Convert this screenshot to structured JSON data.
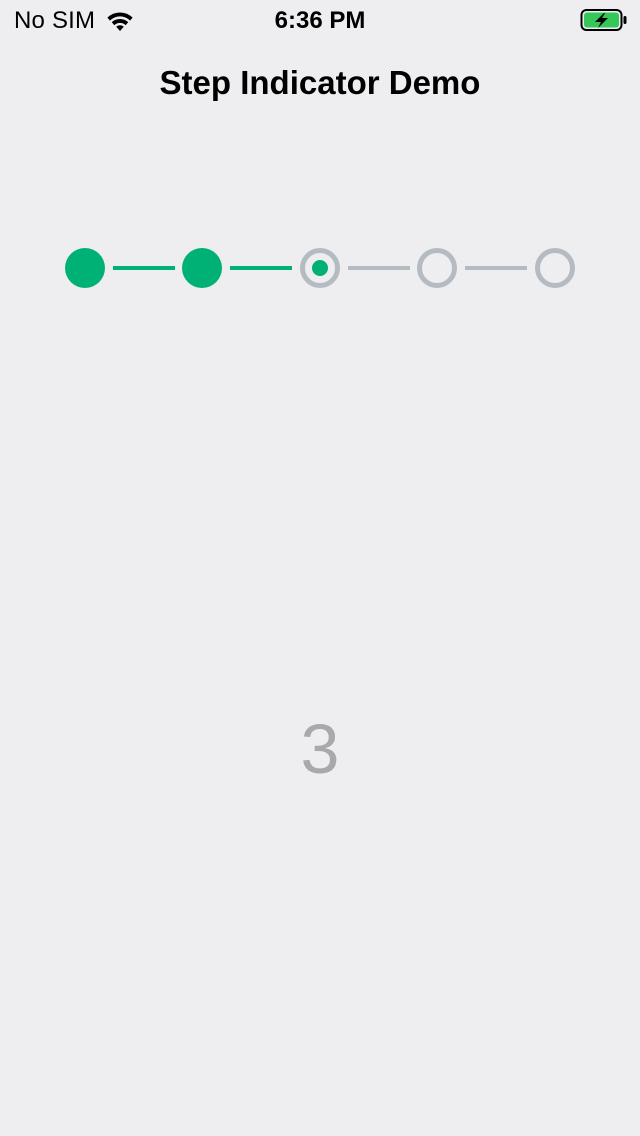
{
  "status_bar": {
    "carrier": "No SIM",
    "time": "6:36 PM",
    "wifi_icon": "wifi-icon",
    "battery_icon": "battery-charging-icon",
    "battery_color": "#35C759"
  },
  "nav": {
    "title": "Step Indicator Demo"
  },
  "stepper": {
    "step_count": 5,
    "current_step": 3,
    "finished_color": "#00B176",
    "unfinished_color": "#B4BBC1"
  },
  "content": {
    "current_step_label": "3"
  }
}
